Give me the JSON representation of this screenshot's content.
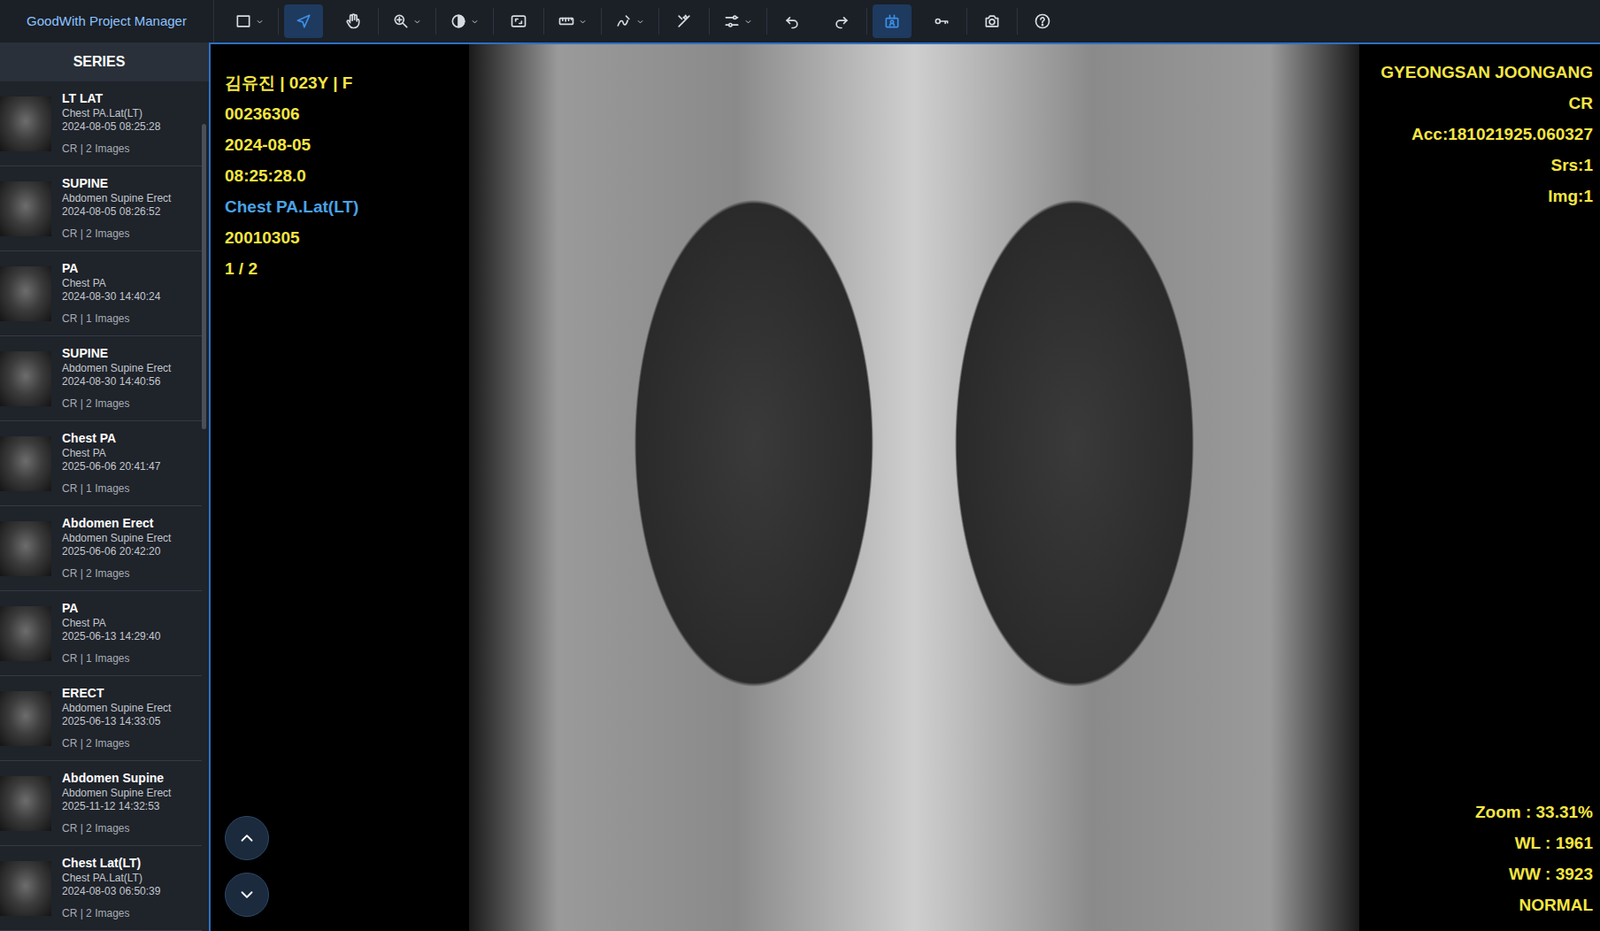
{
  "app": {
    "title": "GoodWith Project Manager"
  },
  "toolbar": [
    {
      "dropdown": true,
      "selected": false
    },
    {
      "dropdown": false,
      "selected": true
    },
    {
      "dropdown": false,
      "selected": false
    },
    {
      "dropdown": true,
      "selected": false
    },
    {
      "dropdown": true,
      "selected": false
    },
    {
      "dropdown": false,
      "selected": false
    },
    {
      "dropdown": true,
      "selected": false
    },
    {
      "dropdown": true,
      "selected": false
    },
    {
      "dropdown": false,
      "selected": false
    },
    {
      "dropdown": true,
      "selected": false
    },
    {
      "dropdown": false,
      "selected": false
    },
    {
      "dropdown": false,
      "selected": false
    },
    {
      "dropdown": false,
      "selected": true
    },
    {
      "dropdown": false,
      "selected": false
    },
    {
      "dropdown": false,
      "selected": false
    },
    {
      "dropdown": false,
      "selected": false
    }
  ],
  "sidebar": {
    "title": "SERIES",
    "items": [
      {
        "title": "LT LAT",
        "description": "Chest PA.Lat(LT)",
        "date": "2024-08-05 08:25:28",
        "info": "CR | 2 Images"
      },
      {
        "title": "SUPINE",
        "description": "Abdomen Supine Erect",
        "date": "2024-08-05 08:26:52",
        "info": "CR | 2 Images"
      },
      {
        "title": "PA",
        "description": "Chest PA",
        "date": "2024-08-30 14:40:24",
        "info": "CR | 1 Images"
      },
      {
        "title": "SUPINE",
        "description": "Abdomen Supine Erect",
        "date": "2024-08-30 14:40:56",
        "info": "CR | 2 Images"
      },
      {
        "title": "Chest PA",
        "description": "Chest PA",
        "date": "2025-06-06 20:41:47",
        "info": "CR | 1 Images"
      },
      {
        "title": "Abdomen Erect",
        "description": "Abdomen Supine Erect",
        "date": "2025-06-06 20:42:20",
        "info": "CR | 2 Images"
      },
      {
        "title": "PA",
        "description": "Chest PA",
        "date": "2025-06-13 14:29:40",
        "info": "CR | 1 Images"
      },
      {
        "title": "ERECT",
        "description": "Abdomen Supine Erect",
        "date": "2025-06-13 14:33:05",
        "info": "CR | 2 Images"
      },
      {
        "title": "Abdomen Supine",
        "description": "Abdomen Supine Erect",
        "date": "2025-11-12 14:32:53",
        "info": "CR | 2 Images"
      },
      {
        "title": "Chest Lat(LT)",
        "description": "Chest PA.Lat(LT)",
        "date": "2024-08-03 06:50:39",
        "info": "CR | 2 Images"
      }
    ]
  },
  "viewer": {
    "top_left": [
      {
        "text": "김유진 | 023Y | F",
        "color": "#f5e642"
      },
      {
        "text": "00236306",
        "color": "#f5e642"
      },
      {
        "text": "2024-08-05",
        "color": "#f5e642"
      },
      {
        "text": "08:25:28.0",
        "color": "#f5e642"
      },
      {
        "text": "Chest PA.Lat(LT)",
        "color": "#4aa3e8"
      },
      {
        "text": "20010305",
        "color": "#f5e642"
      },
      {
        "text": "1 / 2",
        "color": "#f5e642"
      }
    ],
    "top_right": [
      "GYEONGSAN JOONGANG",
      "CR",
      "Acc:181021925.060327",
      "Srs:1",
      "Img:1"
    ],
    "bottom_right": [
      "Zoom : 33.31%",
      "WL : 1961",
      "WW : 3923",
      "NORMAL"
    ]
  }
}
